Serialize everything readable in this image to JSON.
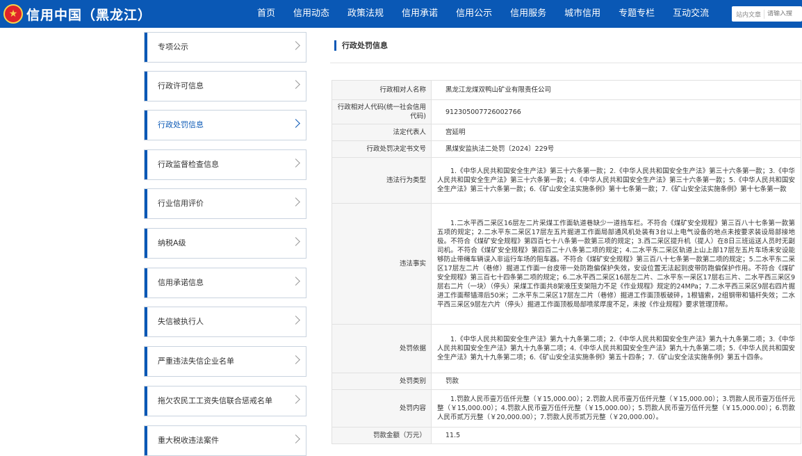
{
  "header": {
    "site_title": "信用中国（黑龙江）",
    "nav": [
      "首页",
      "信用动态",
      "政策法规",
      "信用承诺",
      "信用公示",
      "信用服务",
      "城市信用",
      "专题专栏",
      "互动交流"
    ],
    "search": {
      "scope": "站内文章",
      "placeholder": "请输入搜"
    },
    "colors": {
      "brand": "#0a58b5",
      "emblem": "#e0232a"
    }
  },
  "sidebar": {
    "items": [
      {
        "label": "专项公示"
      },
      {
        "label": "行政许可信息"
      },
      {
        "label": "行政处罚信息",
        "active": true
      },
      {
        "label": "行政监督检查信息"
      },
      {
        "label": "行业信用评价"
      },
      {
        "label": "纳税A级"
      },
      {
        "label": "信用承诺信息"
      },
      {
        "label": "失信被执行人"
      },
      {
        "label": "严重违法失信企业名单"
      },
      {
        "label": "拖欠农民工工资失信联合惩戒名单"
      },
      {
        "label": "重大税收违法案件"
      }
    ]
  },
  "main": {
    "section_title": "行政处罚信息",
    "rows": [
      {
        "key": "行政相对人名称",
        "value": "黑龙江龙煤双鸭山矿业有限责任公司"
      },
      {
        "key": "行政相对人代码(统一社会信用代码)",
        "value": "912305007726002766"
      },
      {
        "key": "法定代表人",
        "value": "宫延明"
      },
      {
        "key": "行政处罚决定书文号",
        "value": "黑煤安监执法二处罚〔2024〕229号"
      },
      {
        "key": "违法行为类型",
        "value": "1.《中华人民共和国安全生产法》第三十六条第一款；2.《中华人民共和国安全生产法》第三十六条第一款；3.《中华人民共和国安全生产法》第三十六条第一款；4.《中华人民共和国安全生产法》第三十六条第一款；5.《中华人民共和国安全生产法》第三十六条第一款；6.《矿山安全法实施条例》第十七条第一款；7.《矿山安全法实施条例》第十七条第一款"
      },
      {
        "key": "违法事实",
        "value": "1.二水平西二采区16层左二片采煤工作面轨道巷缺少一道挡车栏。不符合《煤矿安全规程》第三百八十七条第一款第五项的规定；2.二水平东二采区17层左五片掘进工作面局部通风机处装有3台以上电气设备的地点未按要求装设局部接地极。不符合《煤矿安全规程》第四百七十八条第一款第三项的规定；3.西二采区提升机（提人）在8日三班运送人员时无副司机。不符合《煤矿安全规程》第四百二十八条第二项的规定；4.二水平东二采区轨道上山上部17层左五片车场未安设能够防止带绳车辆误入非运行车场的阻车器。不符合《煤矿安全规程》第三百八十七条第一款第二项的规定；5.二水平东二采区17层左二片（巷修）掘进工作面一台皮带一处防跑偏保护失效，安设位置无法起到皮带防跑偏保护作用。不符合《煤矿安全规程》第三百七十四条第二项的规定；6.二水平西二采区16层左二片、二水平东一采区17层右三片、二水平西三采区9层右二片（一块）（停头）采煤工作面共8架液压支架阻力不足《作业规程》规定的24MPa；7.二水平西三采区9层右四片掘进工作面帮锚滞后50米；二水平东二采区17层左二片（巷修）掘进工作面顶板破碎，1根锚索，2组钢带和锚杆失效；二水平西三采区9层左六片（停头）掘进工作面顶板局部喷浆厚度不足，未按《作业规程》要求管理顶帮。"
      },
      {
        "key": "处罚依据",
        "value": "1.《中华人民共和国安全生产法》第九十九条第二项；2.《中华人民共和国安全生产法》第九十九条第二项；3.《中华人民共和国安全生产法》第九十九条第二项；4.《中华人民共和国安全生产法》第九十九条第二项；5.《中华人民共和国安全生产法》第九十九条第二项；6.《矿山安全法实施条例》第五十四条；7.《矿山安全法实施条例》第五十四条。"
      },
      {
        "key": "处罚类别",
        "value": "罚款"
      },
      {
        "key": "处罚内容",
        "value": "1.罚款人民币壹万伍仟元整（￥15,000.00）；2.罚款人民币壹万伍仟元整（￥15,000.00）；3.罚款人民币壹万伍仟元整（￥15,000.00）；4.罚款人民币壹万伍仟元整（￥15,000.00）；5.罚款人民币壹万伍仟元整（￥15,000.00）；6.罚款人民币贰万元整（￥20,000.00）；7.罚款人民币贰万元整（￥20,000.00）。"
      },
      {
        "key": "罚款金额（万元）",
        "value": "11.5"
      }
    ]
  }
}
